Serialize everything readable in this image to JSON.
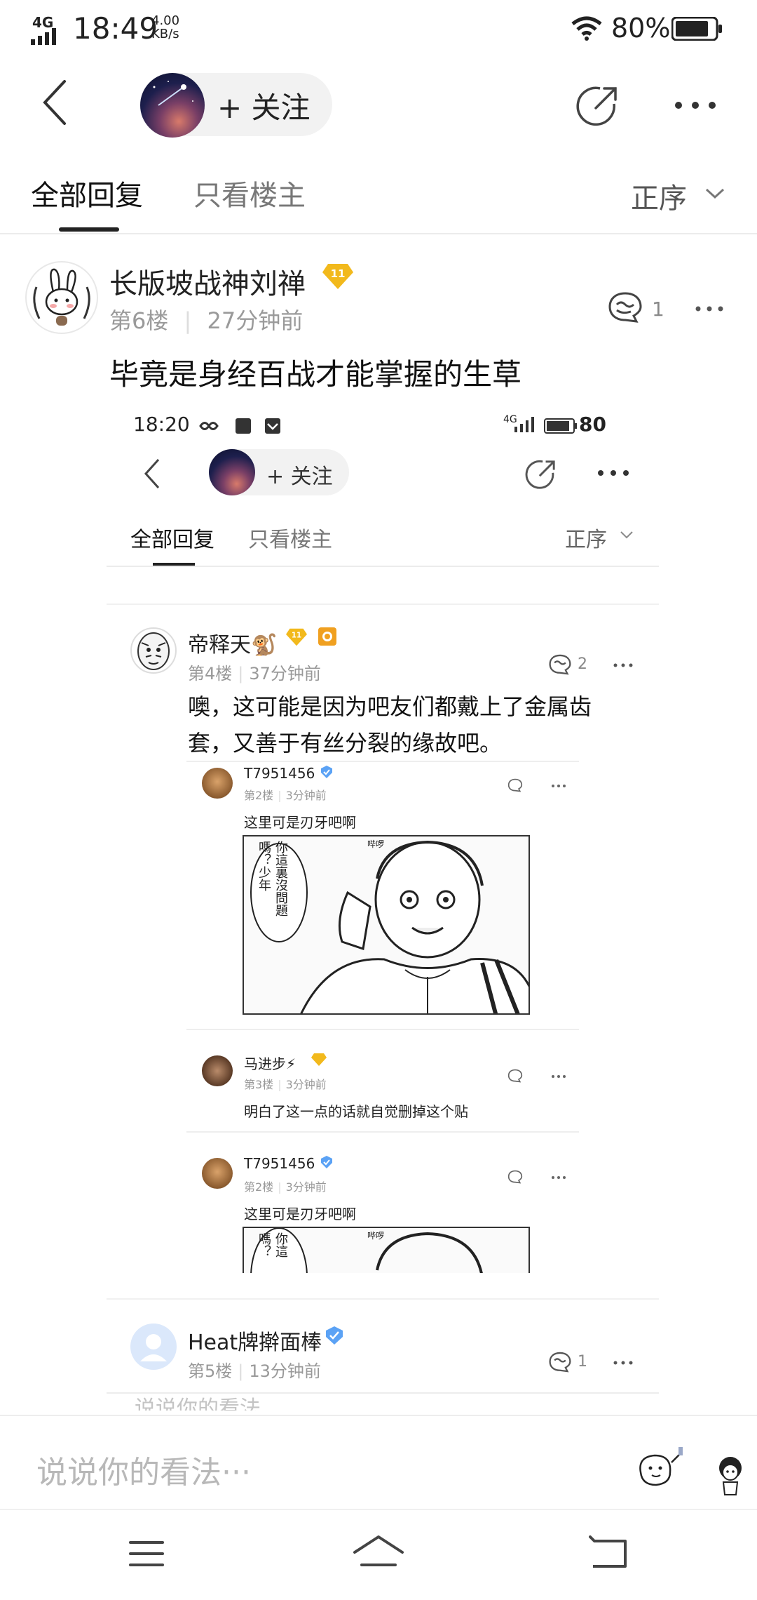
{
  "status_bar": {
    "network": "4G",
    "time": "18:49",
    "speed_value": "4.00",
    "speed_unit": "KB/s",
    "battery": "80%"
  },
  "header": {
    "follow_label": "+ 关注"
  },
  "tabs": {
    "all_replies": "全部回复",
    "owner_only": "只看楼主",
    "sort_label": "正序"
  },
  "post": {
    "username": "长版坡战神刘禅",
    "level": "11",
    "floor": "第6楼",
    "time": "27分钟前",
    "reply_count": "1",
    "text": "毕竟是身经百战才能掌握的生草"
  },
  "embedded": {
    "status_time": "18:20",
    "status_net": "4G",
    "status_battery": "80",
    "follow_label": "+ 关注",
    "tab_all": "全部回复",
    "tab_owner": "只看楼主",
    "sort_label": "正序",
    "reply1": {
      "username": "帝释天🐒",
      "level": "11",
      "floor": "第4楼",
      "time": "37分钟前",
      "reply_count": "2",
      "text_line1": "噢，这可能是因为吧友们都戴上了金属齿",
      "text_line2": "套，又善于有丝分裂的缘故吧。"
    },
    "nested1": {
      "username": "T7951456",
      "floor": "第2楼",
      "time": "3分钟前",
      "text": "这里可是刃牙吧啊",
      "bubble_right": "你這裏沒問題",
      "bubble_left": "嗎？少年",
      "bubble_small": "哔啰"
    },
    "nested2": {
      "username": "马进步⚡",
      "floor": "第3楼",
      "time": "3分钟前",
      "text": "明白了这一点的话就自觉删掉这个贴"
    },
    "nested3": {
      "username": "T7951456",
      "floor": "第2楼",
      "time": "3分钟前",
      "text": "这里可是刃牙吧啊",
      "bubble_right": "你這",
      "bubble_left": "嗎？",
      "bubble_small": "哔啰"
    },
    "reply2": {
      "username": "Heat牌擀面棒",
      "floor": "第5楼",
      "time": "13分钟前",
      "reply_count": "1"
    },
    "input_placeholder": "说说你的看法..."
  },
  "input": {
    "placeholder": "说说你的看法···"
  },
  "icons": {
    "back": "back-arrow-icon",
    "share": "share-icon",
    "more": "more-icon",
    "reply": "reply-icon",
    "level": "level-badge-icon",
    "verified": "verified-icon",
    "emoji": "emoji-sticker-icon",
    "nav_menu": "menu-icon",
    "nav_home": "home-icon",
    "nav_back": "return-icon"
  },
  "colors": {
    "badge_gold": "#f2b91c",
    "verified_blue": "#5ba2f5"
  }
}
